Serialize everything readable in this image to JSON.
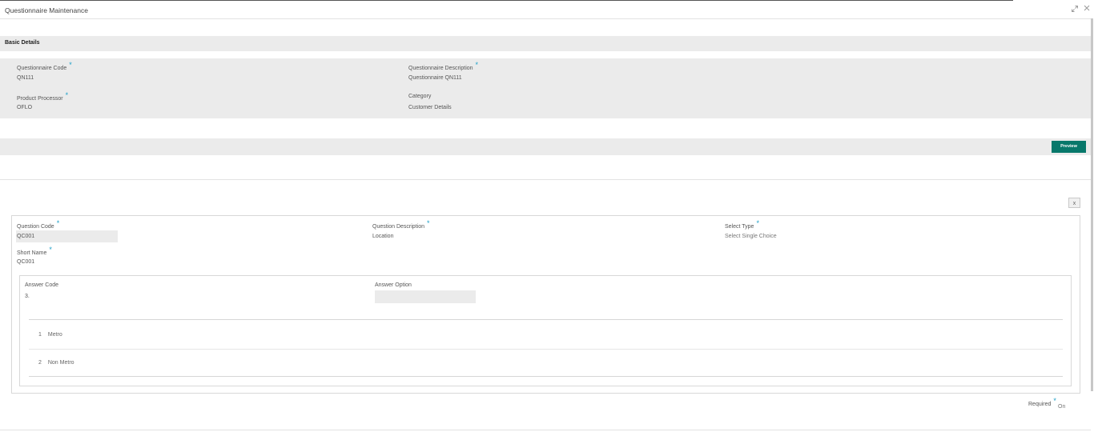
{
  "window": {
    "title": "Questionnaire Maintenance",
    "maximize_icon": "expand-icon",
    "close_icon": "close-icon"
  },
  "basic_details": {
    "title": "Basic Details",
    "questionnaire_code": {
      "label": "Questionnaire Code",
      "value": "QN111",
      "required": "*"
    },
    "questionnaire_description": {
      "label": "Questionnaire Description",
      "value": "Questionnaire QN111",
      "required": "*"
    },
    "product_processor": {
      "label": "Product Processor",
      "value": "OFLO",
      "required": "*"
    },
    "category": {
      "label": "Category",
      "value": "Customer Details"
    }
  },
  "toolbar": {
    "preview_label": "Preview"
  },
  "question": {
    "close_label": "x",
    "question_code": {
      "label": "Question Code",
      "value": "QC001",
      "required": "*"
    },
    "question_description": {
      "label": "Question Description",
      "value": "Location",
      "required": "*"
    },
    "select_type": {
      "label": "Select Type",
      "value": "Select Single Choice",
      "required": "*"
    },
    "short_name": {
      "label": "Short Name",
      "value": "QC001",
      "required": "*"
    },
    "answers": {
      "answer_code_label": "Answer Code",
      "answer_code_value": "3.",
      "answer_option_label": "Answer Option",
      "answer_option_value": "",
      "options": [
        {
          "num": "1",
          "text": "Metro"
        },
        {
          "num": "2",
          "text": "Non Metro"
        }
      ]
    },
    "required": {
      "label": "Required",
      "asterisk": "*",
      "value": "On"
    }
  }
}
